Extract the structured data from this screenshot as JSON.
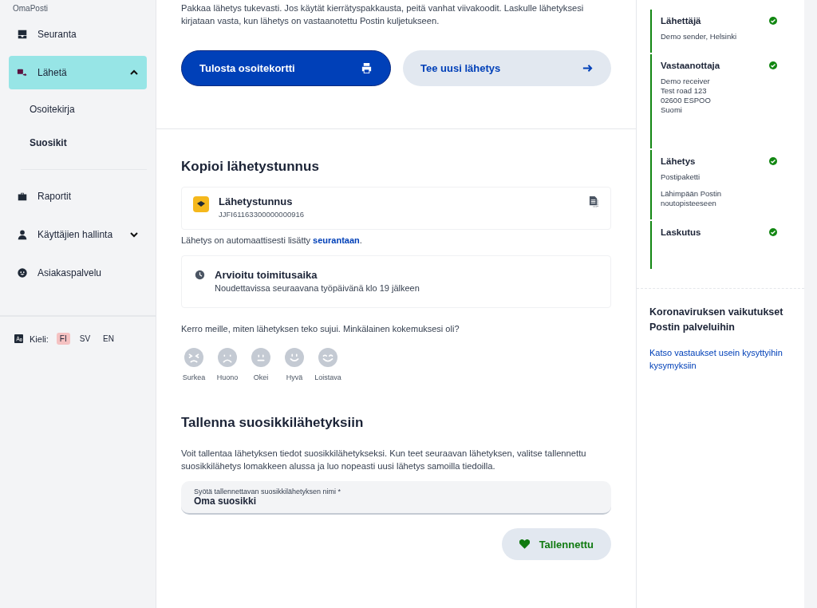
{
  "sidebar": {
    "brand": "OmaPosti",
    "items": [
      {
        "kind": "link",
        "label": "Seuranta",
        "selected": false
      },
      {
        "kind": "group",
        "label": "Lähetä",
        "selected": true,
        "expanded": true,
        "children": [
          {
            "label": "Osoitekirja",
            "selected": false
          },
          {
            "label": "Suosikit",
            "selected": true
          }
        ]
      },
      {
        "kind": "link",
        "label": "Raportit",
        "selected": false
      },
      {
        "kind": "group",
        "label": "Käyttäjien hallinta",
        "selected": false,
        "expanded": false
      },
      {
        "kind": "link",
        "label": "Asiakaspalvelu",
        "selected": false
      }
    ],
    "language": {
      "label": "Kieli:",
      "options": [
        {
          "label": "FI",
          "selected": true
        },
        {
          "label": "SV",
          "selected": false
        },
        {
          "label": "EN",
          "selected": false
        }
      ]
    }
  },
  "main": {
    "intro": "Pakkaa lähetys tukevasti. Jos käytät kierrätyspakkausta, peitä vanhat viivakoodit. Laskulle lähetyksesi kirjataan vasta, kun lähetys on vastaanotettu Postin kuljetukseen.",
    "buttons": [
      {
        "kind": "primary",
        "label": "Tulosta osoitekortti"
      },
      {
        "kind": "secondary",
        "label": "Tee uusi lähetys"
      }
    ],
    "copy_section": {
      "heading": "Kopioi lähetystunnus",
      "tracking_label": "Lähetystunnus",
      "tracking_code": "JJFI61163300000000916",
      "note": "Lähetys on automaattisesti lisätty ",
      "note_link": "seurantaan",
      "note_end": ".",
      "delivery_title": "Arvioitu toimitusaika",
      "delivery_text": "Noudettavissa seuraavana työpäivänä klo 19 jälkeen"
    },
    "feedback": {
      "question": "Kerro meille, miten lähetyksen teko sujui. Minkälainen kokemuksesi oli?",
      "ratings": [
        {
          "label": "Surkea",
          "selected": false
        },
        {
          "label": "Huono",
          "selected": false
        },
        {
          "label": "Okei",
          "selected": false
        },
        {
          "label": "Hyvä",
          "selected": false
        },
        {
          "label": "Loistava",
          "selected": false
        }
      ]
    },
    "favorite": {
      "heading": "Tallenna suosikkilähetyksiin",
      "text": "Voit tallentaa lähetyksen tiedot suosikkilähetykseksi. Kun teet seuraavan lähetyksen, valitse tallennettu suosikkilähetys lomakkeen alussa ja luo nopeasti uusi lähetys samoilla tiedoilla.",
      "field_label": "Syötä tallennettavan suosikkilähetyksen nimi *",
      "field_value": "Oma suosikki",
      "button": "Tallennettu",
      "saved": true
    }
  },
  "summary": {
    "steps": [
      {
        "title": "Lähettäjä",
        "lines": [
          "Demo sender, Helsinki"
        ],
        "done": true
      },
      {
        "title": "Vastaanottaja",
        "lines": [
          "Demo receiver",
          "Test road 123",
          "02600 ESPOO",
          "Suomi"
        ],
        "done": true
      },
      {
        "title": "Lähetys",
        "lines": [
          "Postipaketti",
          "Lähimpään Postin noutopisteeseen"
        ],
        "done": true
      },
      {
        "title": "Laskutus",
        "done": true
      }
    ],
    "info_heading": "Koronaviruksen vaikutukset Postin palveluihin",
    "info_link": "Katso vastaukset usein kysyttyihin kysymyksiin"
  }
}
